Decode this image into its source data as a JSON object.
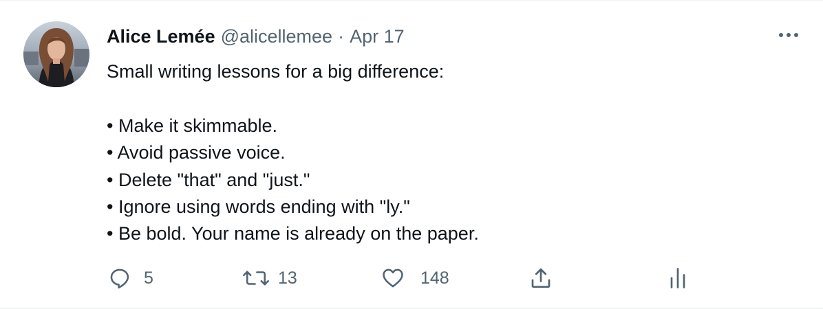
{
  "tweet": {
    "author": {
      "display_name": "Alice Lemée",
      "handle": "@alicellemee",
      "separator": "·",
      "date": "Apr 17"
    },
    "text": {
      "intro": "Small writing lessons for a big difference:",
      "bullets": [
        "• Make it skimmable.",
        "• Avoid passive voice.",
        "• Delete \"that\" and \"just.\"",
        "• Ignore using words ending with \"ly.\"",
        "• Be bold. Your name is already on the paper."
      ]
    },
    "actions": {
      "reply_count": "5",
      "retweet_count": "13",
      "like_count": "148"
    },
    "icons": {
      "reply": "reply-icon",
      "retweet": "retweet-icon",
      "like": "heart-icon",
      "share": "share-icon",
      "analytics": "analytics-icon",
      "more": "more-icon"
    },
    "colors": {
      "text": "#0f1419",
      "secondary": "#536471",
      "border": "#eff3f4"
    }
  }
}
